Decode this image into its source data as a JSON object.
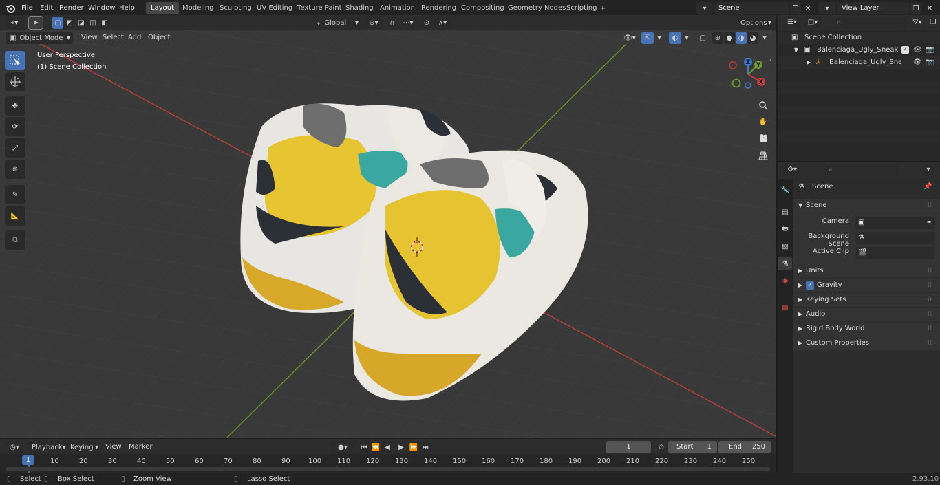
{
  "topbar": {
    "menus": [
      "File",
      "Edit",
      "Render",
      "Window",
      "Help"
    ],
    "workspaces": [
      "Layout",
      "Modeling",
      "Sculpting",
      "UV Editing",
      "Texture Paint",
      "Shading",
      "Animation",
      "Rendering",
      "Compositing",
      "Geometry Nodes",
      "Scripting"
    ],
    "active_workspace": "Layout",
    "scene_field": "Scene",
    "viewlayer_field": "View Layer"
  },
  "header": {
    "transform_orientation": "Global",
    "options_label": "Options",
    "mode": "Object Mode",
    "menus": [
      "View",
      "Select",
      "Add",
      "Object"
    ]
  },
  "viewport": {
    "perspective_label": "User Perspective",
    "collection_label": "(1) Scene Collection",
    "gizmo": {
      "z": "Z",
      "y": "Y",
      "x": "X"
    }
  },
  "outliner": {
    "root": "Scene Collection",
    "items": [
      "Balenciaga_Ugly_Sneakers_Y",
      "Balenciaga_Ugly_Sneake"
    ]
  },
  "properties": {
    "scene_title": "Scene",
    "section": "Scene",
    "fields": [
      {
        "label": "Camera",
        "value": ""
      },
      {
        "label": "Background Scene",
        "value": ""
      },
      {
        "label": "Active Clip",
        "value": ""
      }
    ],
    "panels": [
      "Units",
      "Gravity",
      "Keying Sets",
      "Audio",
      "Rigid Body World",
      "Custom Properties"
    ],
    "gravity_checked": true
  },
  "timeline": {
    "menus": [
      "Playback",
      "Keying",
      "View",
      "Marker"
    ],
    "current_frame": "1",
    "start_label": "Start",
    "start_value": "1",
    "end_label": "End",
    "end_value": "250",
    "ticks": [
      "1",
      "10",
      "20",
      "30",
      "40",
      "50",
      "60",
      "70",
      "80",
      "90",
      "100",
      "110",
      "120",
      "130",
      "140",
      "150",
      "160",
      "170",
      "180",
      "190",
      "200",
      "210",
      "220",
      "230",
      "240",
      "250"
    ]
  },
  "statusbar": {
    "select": "Select",
    "box_select": "Box Select",
    "zoom_view": "Zoom View",
    "lasso_select": "Lasso Select",
    "version": "2.93.10"
  },
  "colors": {
    "accent": "#4772b3",
    "x_axis": "#c33a3a",
    "y_axis": "#6b9c26",
    "background": "#393939"
  }
}
